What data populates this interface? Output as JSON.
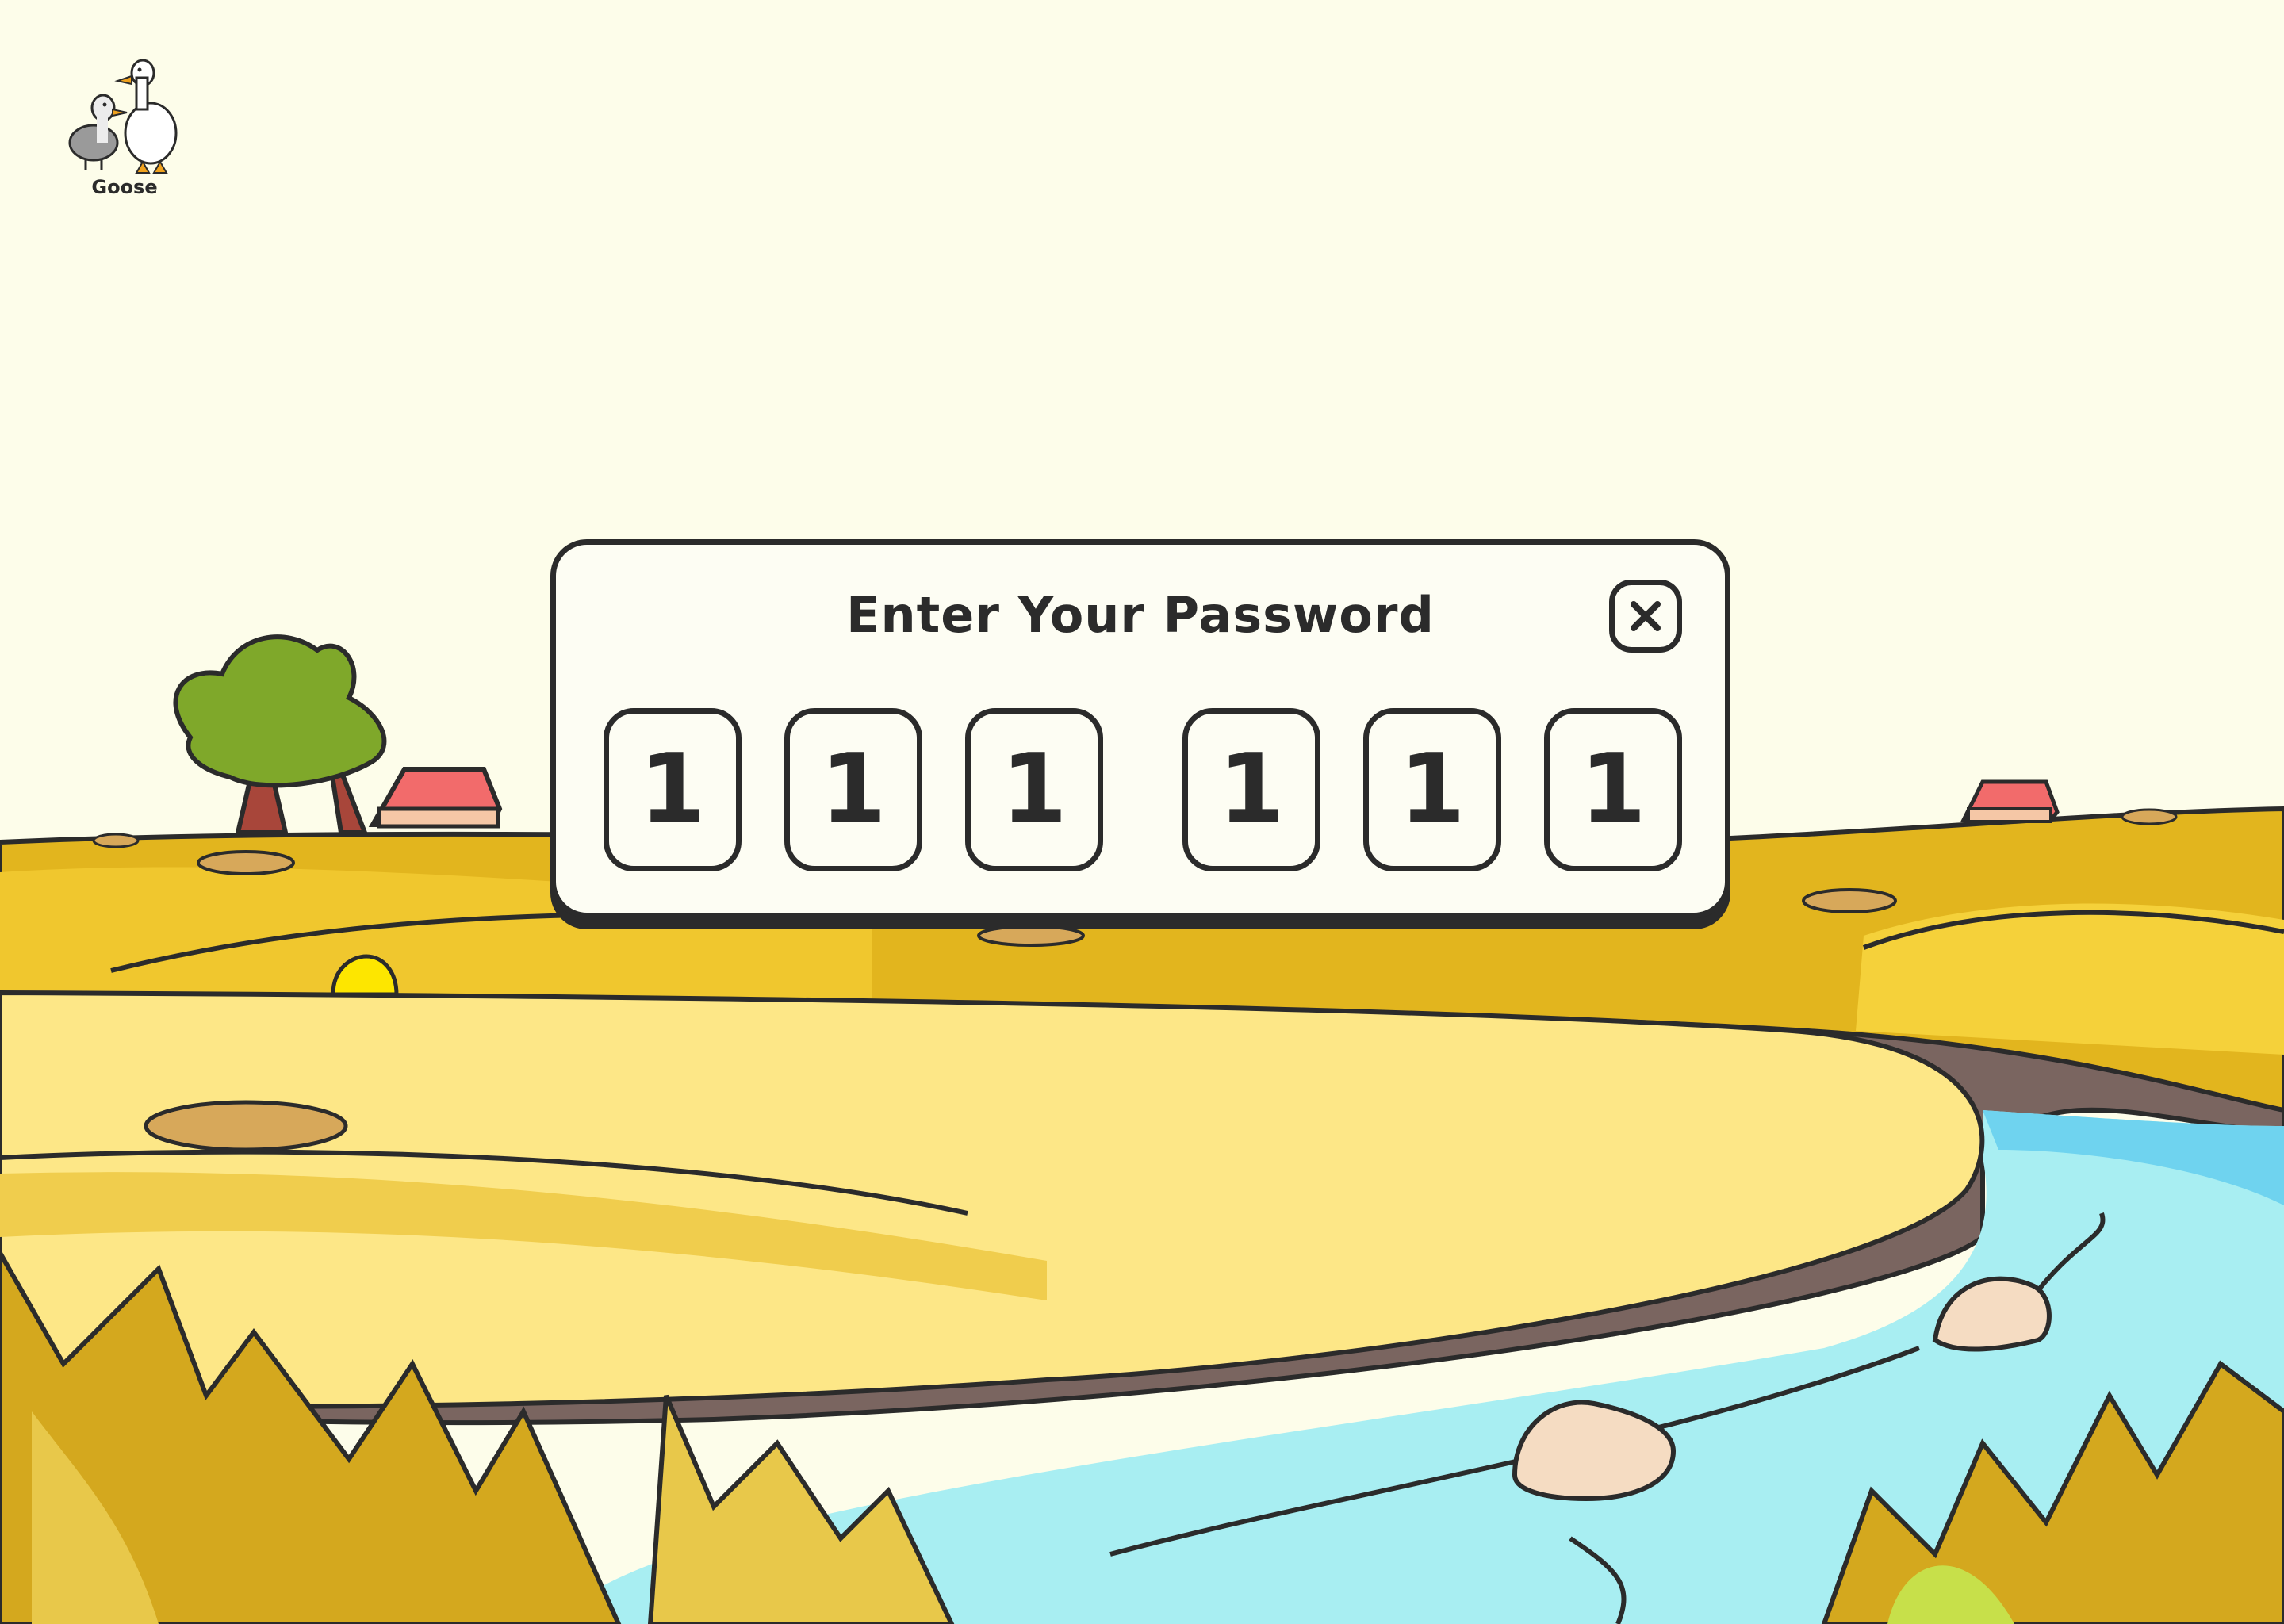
{
  "brand": {
    "name": "Goose",
    "icon": "goose-pair-icon"
  },
  "dialog": {
    "title": "Enter Your Password",
    "close_icon": "close-icon",
    "digits": [
      "1",
      "1",
      "1",
      "1",
      "1",
      "1"
    ]
  },
  "colors": {
    "background": "#fdfdea",
    "outline": "#2b2b2b",
    "field_yellow": "#f5d13a",
    "field_light": "#fde787",
    "river": "#a8eef2",
    "mud": "#7a6560",
    "roof_red": "#f26b6b"
  }
}
